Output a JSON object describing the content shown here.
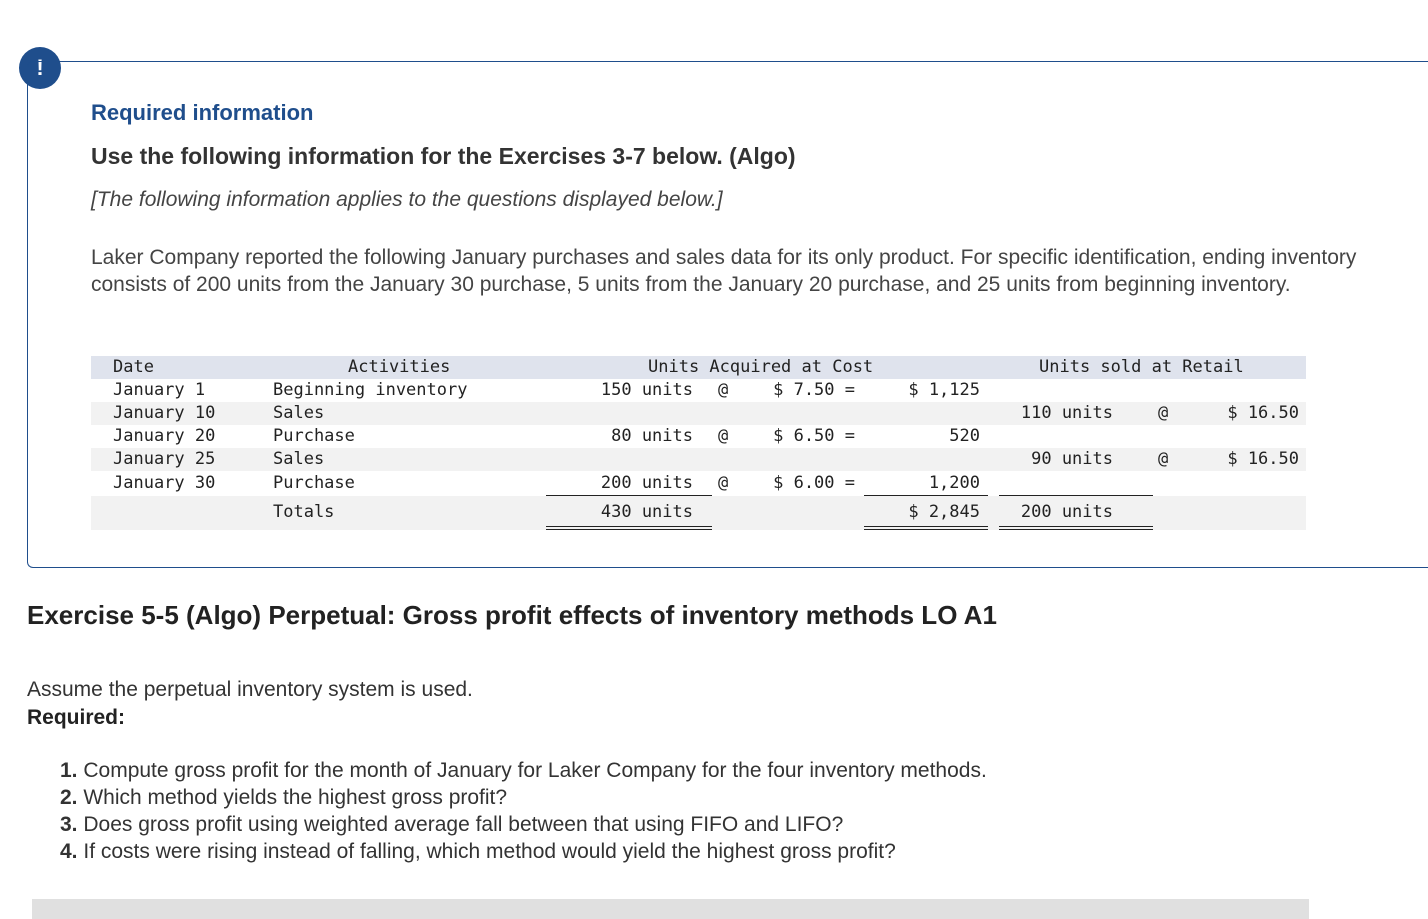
{
  "alert": {
    "icon_glyph": "!"
  },
  "required_info": "Required information",
  "use_heading": "Use the following information for the Exercises 3-7 below. (Algo)",
  "applies_note": "[The following information applies to the questions displayed below.]",
  "intro": "Laker Company reported the following January purchases and sales data for its only product. For specific identification, ending inventory consists of 200 units from the January 30 purchase, 5 units from the January 20 purchase, and 25 units from beginning inventory.",
  "table": {
    "headers": {
      "date": "Date",
      "activities": "Activities",
      "acquired": "Units Acquired at Cost",
      "sold": "Units sold at Retail"
    },
    "rows": [
      {
        "date": "January 1",
        "activity": "Beginning inventory",
        "acq_units": "150 units",
        "acq_at": "@",
        "acq_price": "$ 7.50 =",
        "acq_total": "$ 1,125",
        "sold_units": "",
        "sold_at": "",
        "sold_price": ""
      },
      {
        "date": "January 10",
        "activity": "Sales",
        "acq_units": "",
        "acq_at": "",
        "acq_price": "",
        "acq_total": "",
        "sold_units": "110 units",
        "sold_at": "@",
        "sold_price": "$ 16.50"
      },
      {
        "date": "January 20",
        "activity": "Purchase",
        "acq_units": "80 units",
        "acq_at": "@",
        "acq_price": "$ 6.50 =",
        "acq_total": "520",
        "sold_units": "",
        "sold_at": "",
        "sold_price": ""
      },
      {
        "date": "January 25",
        "activity": "Sales",
        "acq_units": "",
        "acq_at": "",
        "acq_price": "",
        "acq_total": "",
        "sold_units": "90 units",
        "sold_at": "@",
        "sold_price": "$ 16.50"
      },
      {
        "date": "January 30",
        "activity": "Purchase",
        "acq_units": "200 units",
        "acq_at": "@",
        "acq_price": "$ 6.00 =",
        "acq_total": "1,200",
        "sold_units": "",
        "sold_at": "",
        "sold_price": ""
      }
    ],
    "totals": {
      "label": "Totals",
      "acq_units": "430 units",
      "acq_total": "$ 2,845",
      "sold_units": "200 units"
    }
  },
  "exercise_title": "Exercise 5-5 (Algo) Perpetual: Gross profit effects of inventory methods LO A1",
  "assume": "Assume the perpetual inventory system is used.",
  "required_label": "Required:",
  "questions": [
    {
      "num": "1.",
      "text": "Compute gross profit for the month of January for Laker Company for the four inventory methods."
    },
    {
      "num": "2.",
      "text": "Which method yields the highest gross profit?"
    },
    {
      "num": "3.",
      "text": "Does gross profit using weighted average fall between that using FIFO and LIFO?"
    },
    {
      "num": "4.",
      "text": "If costs were rising instead of falling, which method would yield the highest gross profit?"
    }
  ]
}
